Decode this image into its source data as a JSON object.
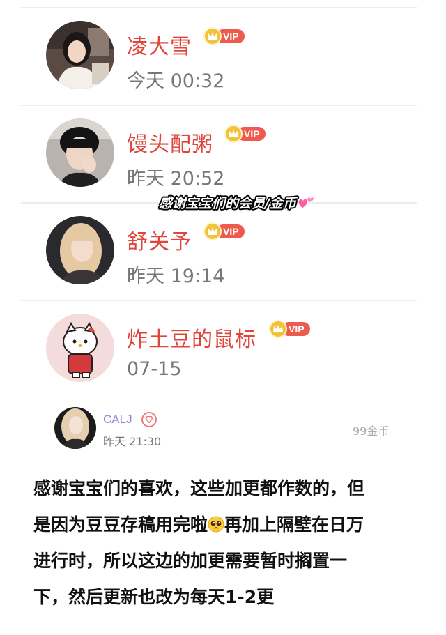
{
  "members": [
    {
      "name": "凌大雪",
      "badge": "VIP",
      "time": "今天 00:32",
      "avatar_desc": "girl-avatar"
    },
    {
      "name": "馒头配粥",
      "badge": "VIP",
      "time": "昨天 20:52",
      "avatar_desc": "boy-avatar"
    },
    {
      "name": "舒关予",
      "badge": "VIP",
      "time": "昨天 19:14",
      "avatar_desc": "blonde-avatar"
    },
    {
      "name": "炸土豆的鼠标",
      "badge": "VIP",
      "time": "07-15",
      "avatar_desc": "hello-kitty-avatar"
    }
  ],
  "overlay_caption": "感谢宝宝们的会员/金币",
  "comment": {
    "username": "CALJ",
    "time": "昨天 21:30",
    "coins": "99金币"
  },
  "message": {
    "line1": "感谢宝宝们的喜欢，这些加更都作数的，但",
    "line2_a": "是因为豆豆存稿用完啦",
    "line2_b": "再加上隔壁在日万",
    "line3": "进行时，所以这边的加更需要暂时搁置一",
    "line4": "下，然后更新也改为每天1-2更"
  },
  "colors": {
    "name_red": "#e0443a",
    "vip_red": "#ef5a4e",
    "crown_gold": "#f3c13a",
    "comment_name_purple": "#9b7fd4"
  }
}
